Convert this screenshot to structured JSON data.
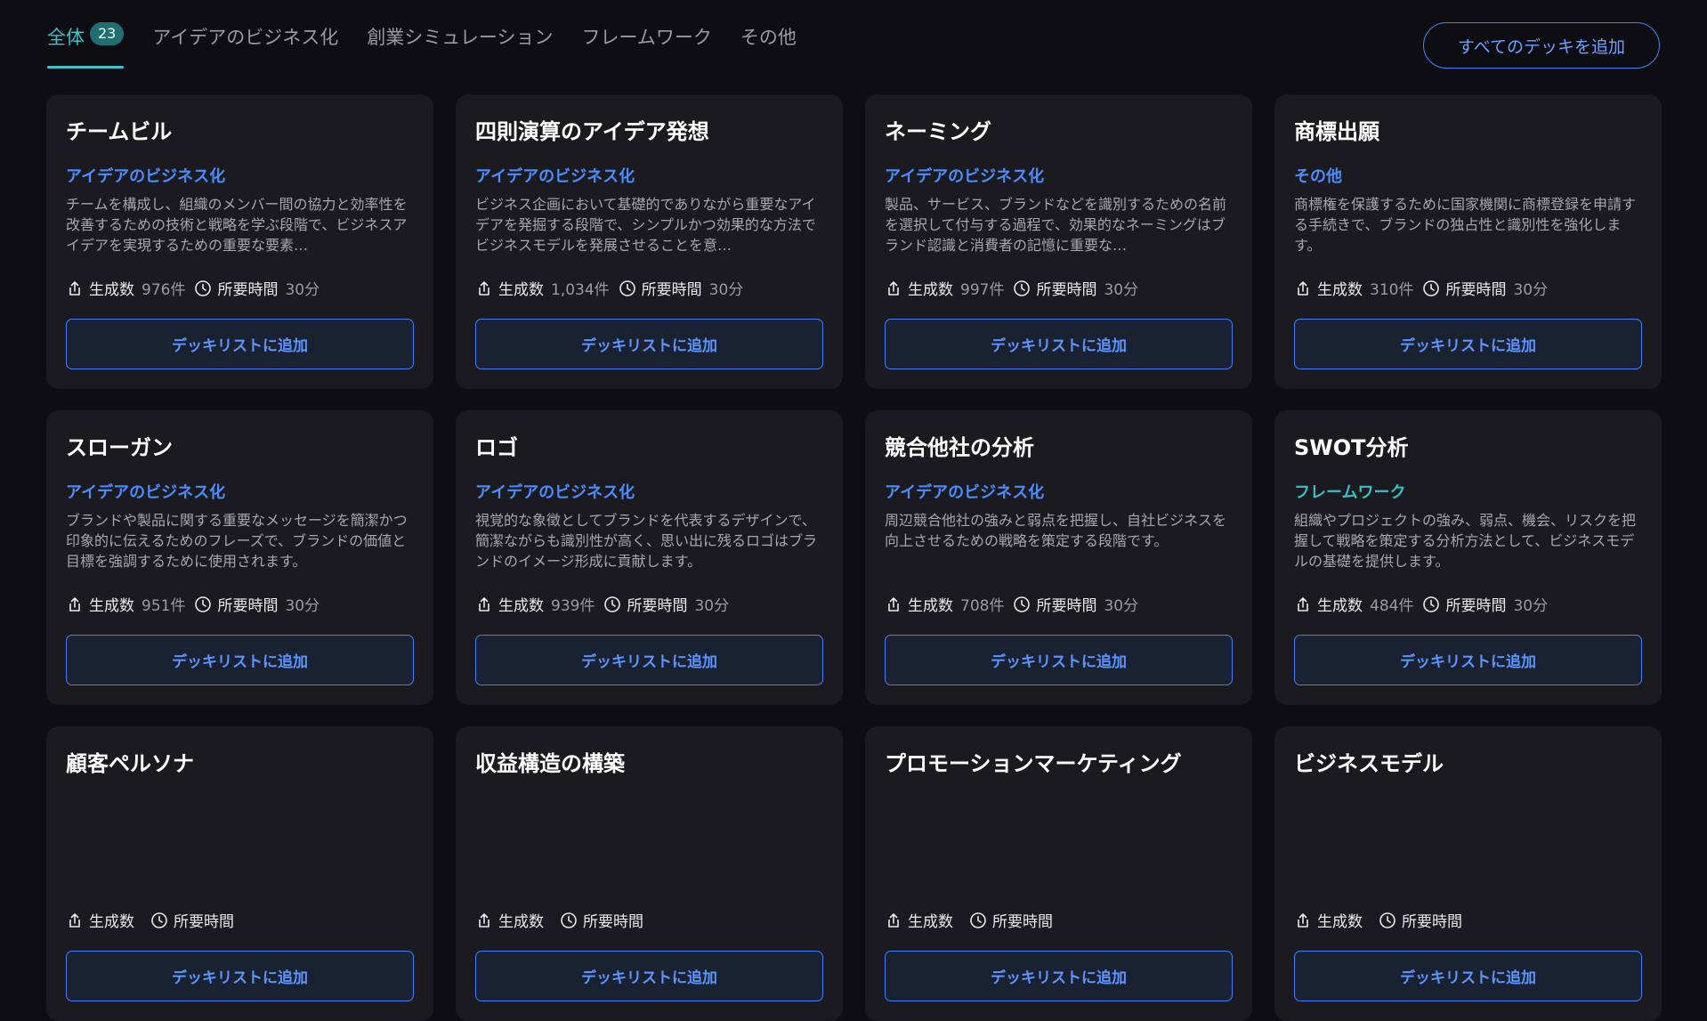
{
  "tabs": [
    {
      "label": "全体",
      "count": "23"
    },
    {
      "label": "アイデアのビジネス化"
    },
    {
      "label": "創業シミュレーション"
    },
    {
      "label": "フレームワーク"
    },
    {
      "label": "その他"
    }
  ],
  "add_all_label": "すべてのデッキを追加",
  "meta_labels": {
    "generated": "生成数",
    "time": "所要時間"
  },
  "add_button_label": "デッキリストに追加",
  "cards": [
    {
      "title": "チームビル",
      "category": "アイデアのビジネス化",
      "description": "チームを構成し、組織のメンバー間の協力と効率性を改善するための技術と戦略を学ぶ段階で、ビジネスアイデアを実現するための重要な要素…",
      "generated": "976件",
      "time": "30分"
    },
    {
      "title": "四則演算のアイデア発想",
      "category": "アイデアのビジネス化",
      "description": "ビジネス企画において基礎的でありながら重要なアイデアを発掘する段階で、シンプルかつ効果的な方法でビジネスモデルを発展させることを意…",
      "generated": "1,034件",
      "time": "30分"
    },
    {
      "title": "ネーミング",
      "category": "アイデアのビジネス化",
      "description": "製品、サービス、ブランドなどを識別するための名前を選択して付与する過程で、効果的なネーミングはブランド認識と消費者の記憶に重要な…",
      "generated": "997件",
      "time": "30分"
    },
    {
      "title": "商標出願",
      "category": "その他",
      "description": "商標権を保護するために国家機関に商標登録を申請する手続きで、ブランドの独占性と識別性を強化します。",
      "generated": "310件",
      "time": "30分"
    },
    {
      "title": "スローガン",
      "category": "アイデアのビジネス化",
      "description": "ブランドや製品に関する重要なメッセージを簡潔かつ印象的に伝えるためのフレーズで、ブランドの価値と目標を強調するために使用されます。",
      "generated": "951件",
      "time": "30分"
    },
    {
      "title": "ロゴ",
      "category": "アイデアのビジネス化",
      "description": "視覚的な象徴としてブランドを代表するデザインで、簡潔ながらも識別性が高く、思い出に残るロゴはブランドのイメージ形成に貢献します。",
      "generated": "939件",
      "time": "30分"
    },
    {
      "title": "競合他社の分析",
      "category": "アイデアのビジネス化",
      "description": "周辺競合他社の強みと弱点を把握し、自社ビジネスを向上させるための戦略を策定する段階です。",
      "generated": "708件",
      "time": "30分"
    },
    {
      "title": "SWOT分析",
      "category": "フレームワーク",
      "category_color": "teal",
      "description": "組織やプロジェクトの強み、弱点、機会、リスクを把握して戦略を策定する分析方法として、ビジネスモデルの基礎を提供します。",
      "generated": "484件",
      "time": "30分"
    },
    {
      "title": "顧客ペルソナ",
      "category": "",
      "description": "",
      "generated": "",
      "time": ""
    },
    {
      "title": "収益構造の構築",
      "category": "",
      "description": "",
      "generated": "",
      "time": ""
    },
    {
      "title": "プロモーションマーケティング",
      "category": "",
      "description": "",
      "generated": "",
      "time": ""
    },
    {
      "title": "ビジネスモデル",
      "category": "",
      "description": "",
      "generated": "",
      "time": ""
    }
  ]
}
